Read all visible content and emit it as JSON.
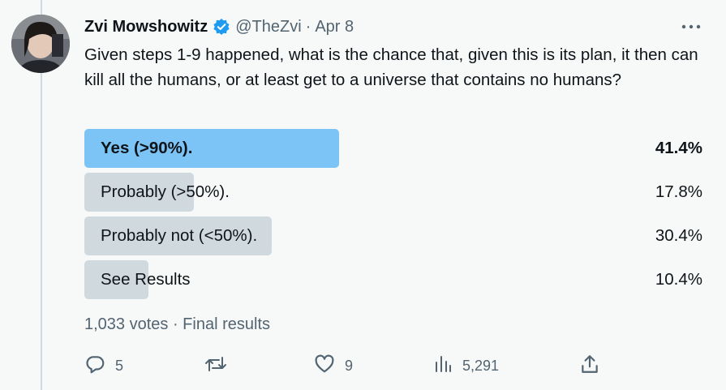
{
  "tweet": {
    "author_name": "Zvi Mowshowitz",
    "handle": "@TheZvi",
    "separator": "·",
    "date": "Apr 8",
    "text": "Given steps 1-9 happened, what is the chance that, given this is its plan, it then can kill all the humans, or at least get to a universe that contains no humans?"
  },
  "poll": {
    "options": [
      {
        "label": "Yes (>90%).",
        "percent_text": "41.4%",
        "percent": 41.4,
        "winner": true
      },
      {
        "label": "Probably (>50%).",
        "percent_text": "17.8%",
        "percent": 17.8,
        "winner": false
      },
      {
        "label": "Probably not (<50%).",
        "percent_text": "30.4%",
        "percent": 30.4,
        "winner": false
      },
      {
        "label": "See Results",
        "percent_text": "10.4%",
        "percent": 10.4,
        "winner": false
      }
    ],
    "footer": "1,033 votes · Final results"
  },
  "actions": {
    "replies": "5",
    "reposts": "",
    "likes": "9",
    "views": "5,291"
  },
  "colors": {
    "winner_bar": "#7cc3f6",
    "bar": "#cfd9de",
    "verified": "#1d9bf0",
    "muted": "#536471"
  },
  "icons": [
    "verified-badge-icon",
    "more-icon",
    "reply-icon",
    "repost-icon",
    "like-icon",
    "views-icon",
    "share-icon"
  ]
}
